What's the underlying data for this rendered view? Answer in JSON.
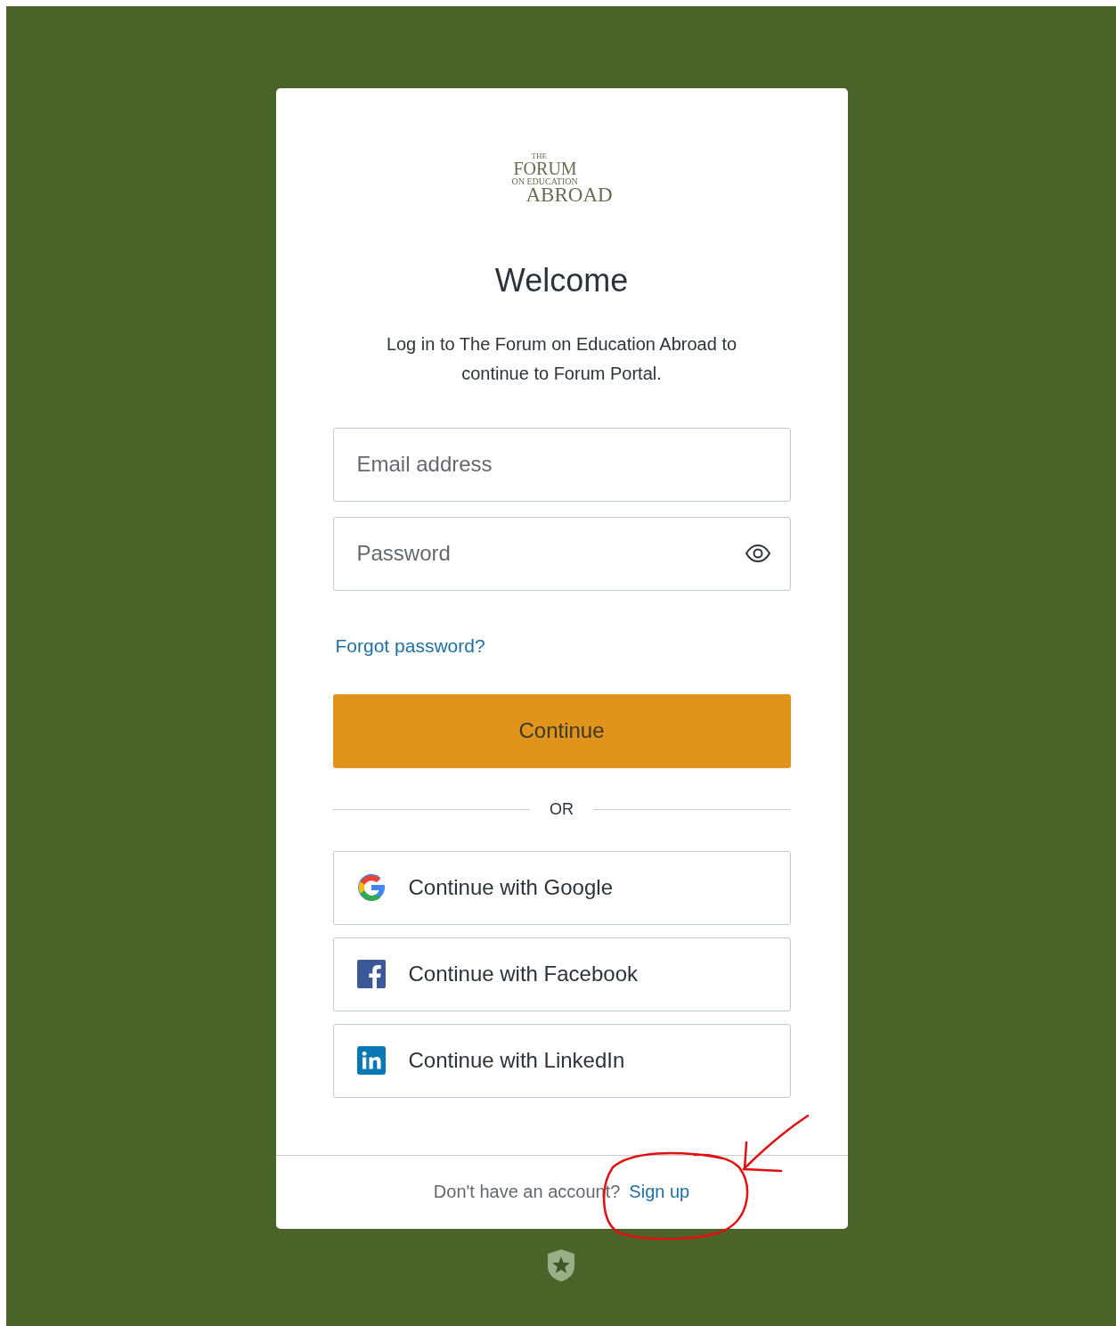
{
  "logo": {
    "lines": [
      "THE",
      "FORUM",
      "ON EDUCATION",
      "ABROAD"
    ]
  },
  "title": "Welcome",
  "subtitle": "Log in to The Forum on Education Abroad to continue to Forum Portal.",
  "fields": [
    {
      "kind": "email",
      "placeholder": "Email address"
    },
    {
      "kind": "password",
      "placeholder": "Password"
    }
  ],
  "forgot_link": "Forgot password?",
  "primary_button": "Continue",
  "divider": "OR",
  "social_buttons": [
    {
      "kind": "google",
      "label": "Continue with Google"
    },
    {
      "kind": "facebook",
      "label": "Continue with Facebook"
    },
    {
      "kind": "linkedin",
      "label": "Continue with LinkedIn"
    }
  ],
  "footer": {
    "text": "Don't have an account?",
    "link": "Sign up"
  }
}
